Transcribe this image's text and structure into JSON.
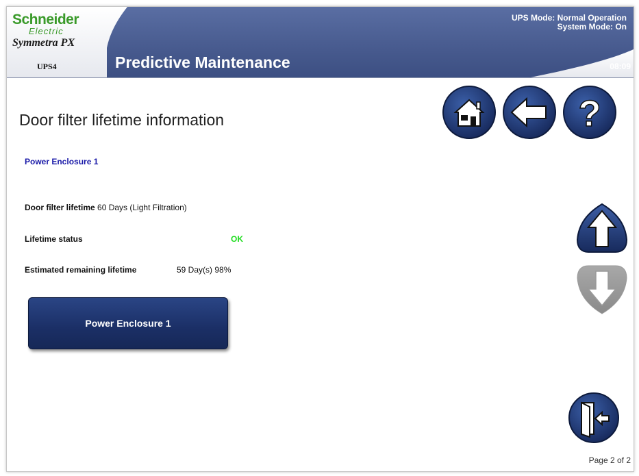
{
  "header": {
    "brand_top": "Schneider",
    "brand_bottom": "Electric",
    "product": "Symmetra PX",
    "ups_id": "UPS4",
    "page_heading": "Predictive Maintenance",
    "ups_mode": "UPS Mode: Normal Operation",
    "system_mode": "System Mode: On",
    "clock": "08:09"
  },
  "toolbar": {
    "home_icon": "home-icon",
    "back_icon": "back-arrow-icon",
    "help_icon": "help-icon"
  },
  "content": {
    "title": "Door filter lifetime information",
    "section": "Power Enclosure 1",
    "rows": [
      {
        "label": "Door filter lifetime",
        "value": "60 Days (Light Filtration)"
      },
      {
        "label": "Lifetime status",
        "value": "OK"
      },
      {
        "label": "Estimated remaining lifetime",
        "value": "59 Day(s) 98%"
      }
    ],
    "enclosure_button": "Power Enclosure 1"
  },
  "nav": {
    "scroll_up_icon": "arrow-up-icon",
    "scroll_down_icon": "arrow-down-icon",
    "exit_icon": "exit-door-icon"
  },
  "footer": {
    "page_indicator": "Page 2 of 2"
  },
  "colors": {
    "header_blue": "#4b5f93",
    "button_navy": "#1b2f66",
    "status_ok": "#22dd22",
    "section_blue": "#1a1aa8",
    "brand_green": "#3a9a2a"
  }
}
